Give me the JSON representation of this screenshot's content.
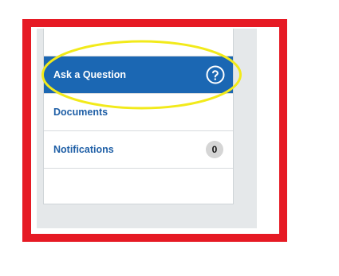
{
  "nav": {
    "items": [
      {
        "label": "Ask a Question",
        "icon": "help-circle-icon",
        "active": true
      },
      {
        "label": "Documents",
        "active": false
      },
      {
        "label": "Notifications",
        "badge": "0",
        "active": false
      }
    ]
  },
  "colors": {
    "frame": "#e61a24",
    "active_item": "#1b67b3",
    "link_text": "#1f5fa6",
    "highlight_ellipse": "#f2ea1a",
    "panel_bg": "#e5e8ea"
  }
}
